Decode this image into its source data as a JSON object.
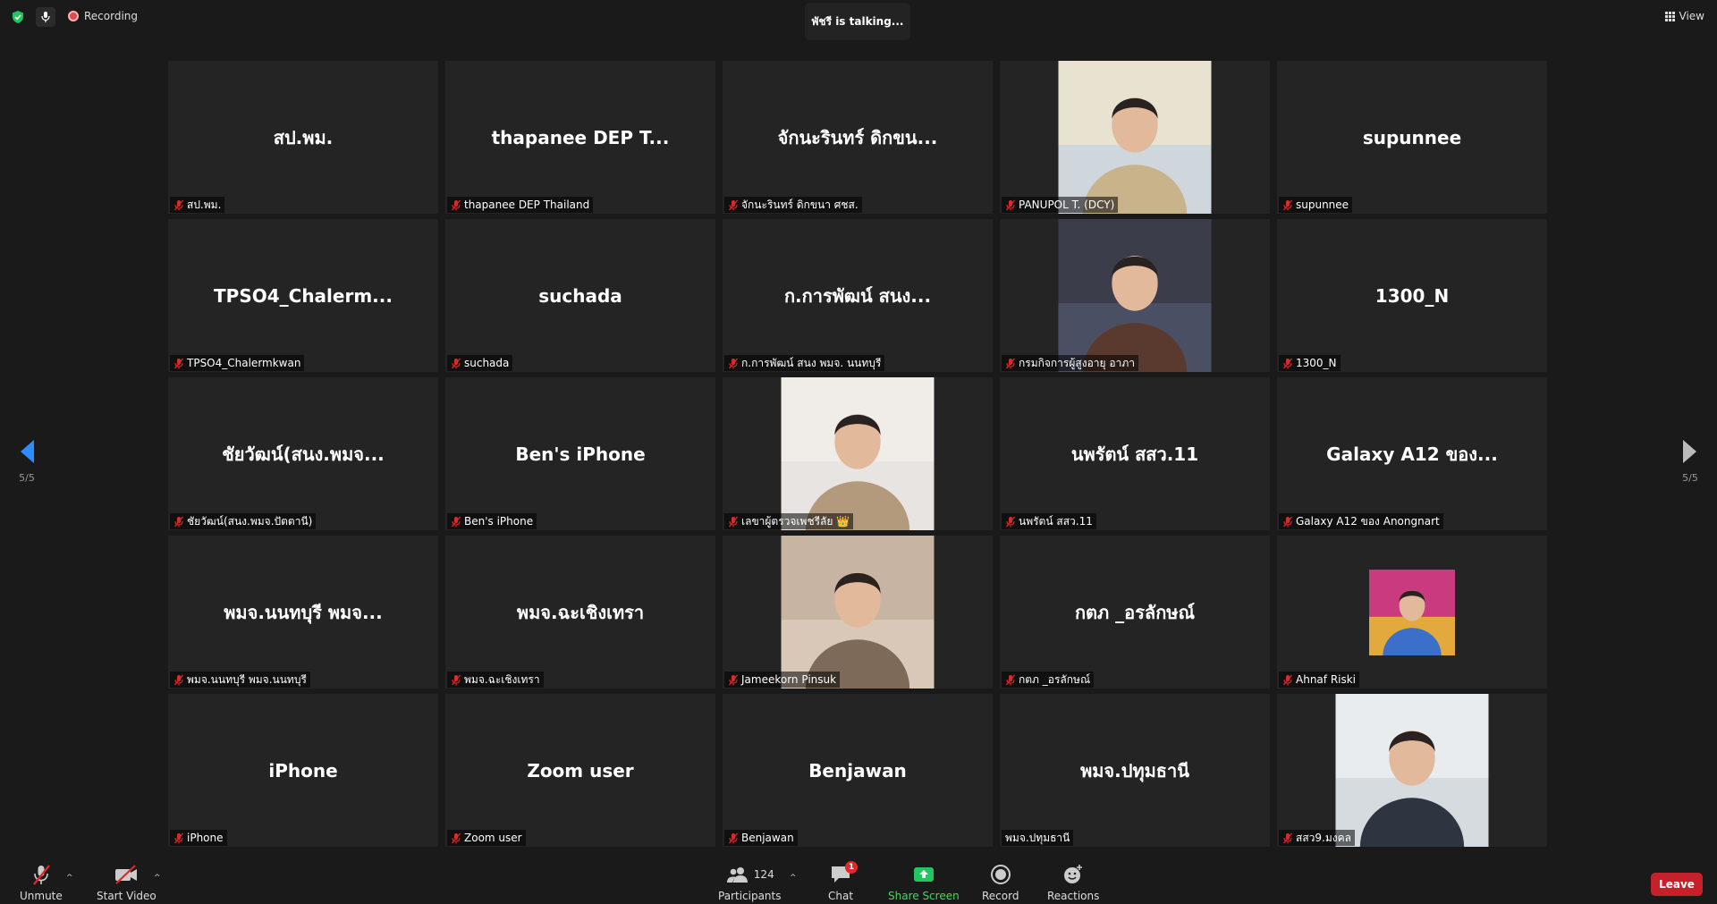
{
  "top": {
    "recording_label": "Recording",
    "talking": "พัชรี is  talking...",
    "view_label": "View"
  },
  "pager": {
    "left": "5/5",
    "right": "5/5"
  },
  "tiles": [
    {
      "big": "สป.พม.",
      "label": "สป.พม.",
      "video": false,
      "muted": true
    },
    {
      "big": "thapanee DEP T...",
      "label": "thapanee DEP Thailand",
      "video": false,
      "muted": true
    },
    {
      "big": "จักนะรินทร์ ดิกขน...",
      "label": "จักนะรินทร์ ดิกขนา ศชส.",
      "video": false,
      "muted": true
    },
    {
      "big": "",
      "label": "PANUPOL T. (DCY)",
      "video": true,
      "muted": true
    },
    {
      "big": "supunnee",
      "label": "supunnee",
      "video": false,
      "muted": true
    },
    {
      "big": "TPSO4_Chalerm...",
      "label": "TPSO4_Chalermkwan",
      "video": false,
      "muted": true
    },
    {
      "big": "suchada",
      "label": "suchada",
      "video": false,
      "muted": true
    },
    {
      "big": "ก.การพัฒน์ สนง...",
      "label": "ก.การพัฒน์ สนง พมจ. นนทบุรี",
      "video": false,
      "muted": true
    },
    {
      "big": "",
      "label": "กรมกิจการผู้สูงอายุ อาภา",
      "video": true,
      "muted": true
    },
    {
      "big": "1300_N",
      "label": "1300_N",
      "video": false,
      "muted": true
    },
    {
      "big": "ชัยวัฒน์(สนง.พมจ...",
      "label": "ชัยวัฒน์(สนง.พมจ.ปัตตานี)",
      "video": false,
      "muted": true
    },
    {
      "big": "Ben's iPhone",
      "label": "Ben's iPhone",
      "video": false,
      "muted": true
    },
    {
      "big": "",
      "label": "เลขาผู้ตรวจเพชรีลัย 👑",
      "video": true,
      "muted": true
    },
    {
      "big": "นพรัตน์ สสว.11",
      "label": "นพรัตน์ สสว.11",
      "video": false,
      "muted": true
    },
    {
      "big": "Galaxy A12 ของ...",
      "label": "Galaxy A12 ของ Anongnart",
      "video": false,
      "muted": true
    },
    {
      "big": "พมจ.นนทบุรี พมจ...",
      "label": "พมจ.นนทบุรี พมจ.นนทบุรี",
      "video": false,
      "muted": true
    },
    {
      "big": "พมจ.ฉะเชิงเทรา",
      "label": "พมจ.ฉะเชิงเทรา",
      "video": false,
      "muted": true
    },
    {
      "big": "",
      "label": "Jameekorn Pinsuk",
      "video": true,
      "muted": true
    },
    {
      "big": "กตภ _อรลักษณ์",
      "label": "กตภ _อรลักษณ์",
      "video": false,
      "muted": true
    },
    {
      "big": "",
      "label": "Ahnaf Riski",
      "video": true,
      "muted": true,
      "small": true
    },
    {
      "big": "iPhone",
      "label": "iPhone",
      "video": false,
      "muted": true
    },
    {
      "big": "Zoom user",
      "label": "Zoom user",
      "video": false,
      "muted": true
    },
    {
      "big": "Benjawan",
      "label": "Benjawan",
      "video": false,
      "muted": true
    },
    {
      "big": "พมจ.ปทุมธานี",
      "label": "พมจ.ปทุมธานี",
      "video": false,
      "muted": false
    },
    {
      "big": "",
      "label": "สสว9.มงคล",
      "video": true,
      "muted": true
    }
  ],
  "toolbar": {
    "unmute": "Unmute",
    "start_video": "Start Video",
    "participants": "Participants",
    "participants_count": "124",
    "chat": "Chat",
    "chat_badge": "1",
    "share_screen": "Share Screen",
    "record": "Record",
    "reactions": "Reactions",
    "leave": "Leave"
  },
  "colors": {
    "background": "#1a1a1a",
    "tile": "#242424",
    "share_green": "#3ddc5c",
    "leave_red": "#c6202a",
    "accent_blue": "#2d8cff"
  }
}
